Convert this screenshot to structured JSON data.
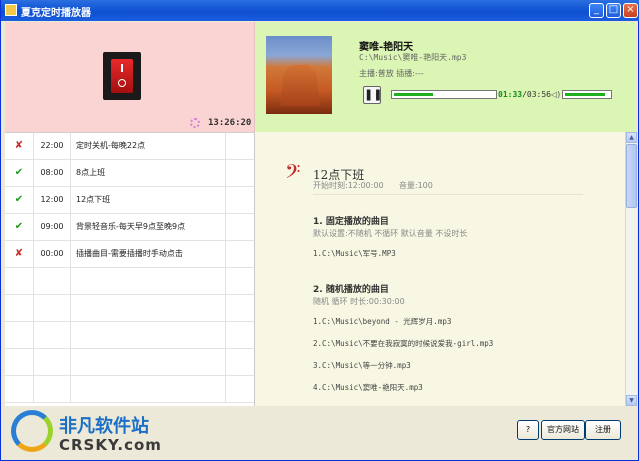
{
  "window": {
    "title": "夏克定时播放器"
  },
  "status": {
    "clock": "13:26:20"
  },
  "player": {
    "song_title": "窦唯-艳阳天",
    "song_path": "C:\\Music\\窦唯-艳阳天.mp3",
    "meta": "主播:普放    插播:---",
    "current_time": "01:33",
    "total_time": "/03:56",
    "progress": 0.39,
    "volume": 0.9
  },
  "tasks": [
    {
      "status": "x",
      "time": "22:00",
      "name": "定时关机-每晚22点"
    },
    {
      "status": "ok",
      "time": "08:00",
      "name": "8点上班"
    },
    {
      "status": "ok",
      "time": "12:00",
      "name": "12点下班"
    },
    {
      "status": "ok",
      "time": "09:00",
      "name": "背景轻音乐-每天早9点至晚9点"
    },
    {
      "status": "x",
      "time": "00:00",
      "name": "插播曲目-需要插播时手动点击"
    }
  ],
  "detail": {
    "title": "12点下班",
    "start": "开始时刻:12:00:00",
    "volume": "音量:100",
    "section1_title": "1. 固定播放的曲目",
    "section1_sub": "默认设置:不随机  不循环  默认音量  不设时长",
    "section1_items": [
      "1.C:\\Music\\军号.MP3"
    ],
    "section2_title": "2. 随机播放的曲目",
    "section2_sub": "随机    循环    时长:00:30:00",
    "section2_items": [
      "1.C:\\Music\\beyond - 光辉岁月.mp3",
      "2.C:\\Music\\不要在我寂寞的时候说爱我-girl.mp3",
      "3.C:\\Music\\等一分钟.mp3",
      "4.C:\\Music\\窦唯-艳阳天.mp3"
    ]
  },
  "buttons": {
    "help": "?",
    "website": "官方网站",
    "register": "注册"
  },
  "watermark": {
    "cn": "非凡软件站",
    "en": "CRSKY.com"
  },
  "icons": {
    "status_x": "✘",
    "status_ok": "✔",
    "pause": "❚❚",
    "clef": "𝄢"
  }
}
